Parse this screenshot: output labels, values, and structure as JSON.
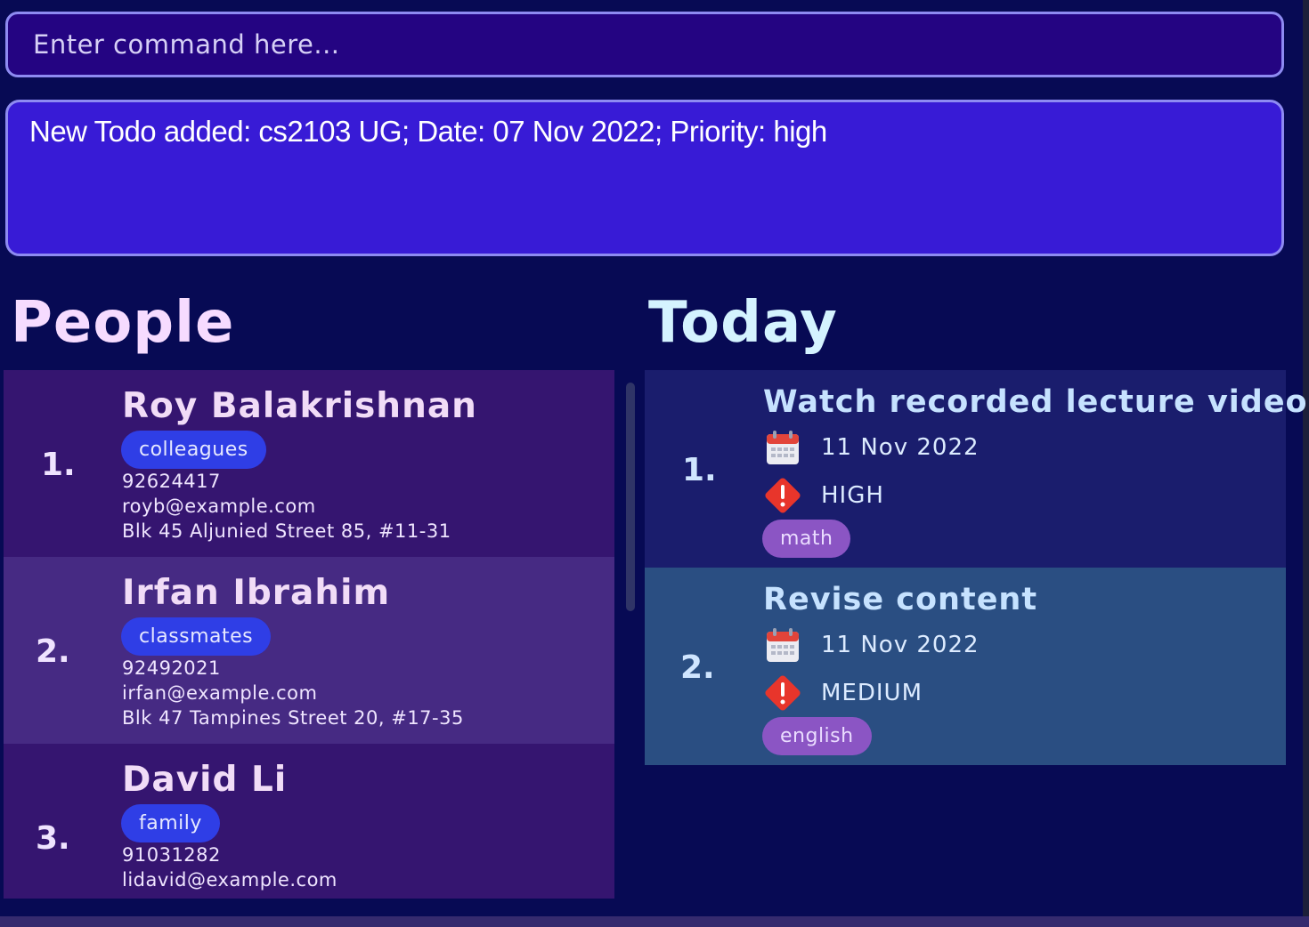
{
  "command": {
    "placeholder": "Enter command here..."
  },
  "result": {
    "text": "New Todo added: cs2103 UG; Date: 07 Nov 2022; Priority: high"
  },
  "people": {
    "title": "People",
    "items": [
      {
        "index": "1.",
        "name": "Roy Balakrishnan",
        "tag": "colleagues",
        "phone": "92624417",
        "email": "royb@example.com",
        "address": "Blk 45 Aljunied Street 85, #11-31"
      },
      {
        "index": "2.",
        "name": "Irfan Ibrahim",
        "tag": "classmates",
        "phone": "92492021",
        "email": "irfan@example.com",
        "address": "Blk 47 Tampines Street 20, #17-35"
      },
      {
        "index": "3.",
        "name": "David Li",
        "tag": "family",
        "phone": "91031282",
        "email": "lidavid@example.com",
        "address": ""
      }
    ]
  },
  "today": {
    "title": "Today",
    "items": [
      {
        "index": "1.",
        "title": "Watch recorded lecture videos",
        "date": "11 Nov 2022",
        "priority": "HIGH",
        "tag": "math"
      },
      {
        "index": "2.",
        "title": "Revise content",
        "date": "11 Nov 2022",
        "priority": "MEDIUM",
        "tag": "english"
      }
    ]
  },
  "icons": {
    "date": "calendar-icon",
    "priority": "exclamation-diamond-icon"
  },
  "colors": {
    "accent_border": "#8e8bf2",
    "person_tag": "#2f3ee6",
    "todo_tag": "#8b55c4",
    "priority_red": "#e8352b"
  }
}
